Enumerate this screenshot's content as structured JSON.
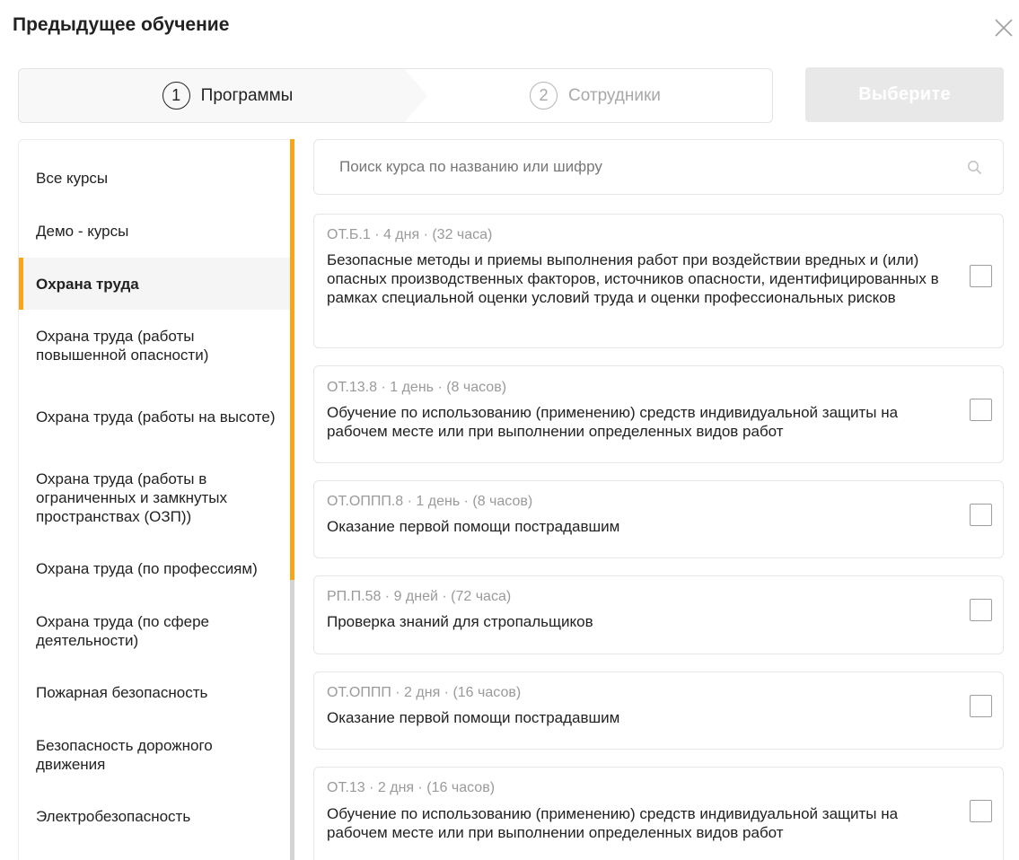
{
  "dialog": {
    "title": "Предыдущее обучение"
  },
  "stepper": {
    "steps": [
      {
        "number": "1",
        "label": "Программы",
        "active": true
      },
      {
        "number": "2",
        "label": "Сотрудники",
        "active": false
      }
    ]
  },
  "actions": {
    "select_label": "Выберите"
  },
  "sidebar": {
    "items": [
      {
        "label": "Все курсы"
      },
      {
        "label": "Демо - курсы"
      },
      {
        "label": "Охрана труда",
        "active": true
      },
      {
        "label": "Охрана труда (работы повышенной опасности)"
      },
      {
        "label": "Охрана труда (работы на высоте)"
      },
      {
        "label": "Охрана труда (работы в ограниченных и замкнутых пространствах (ОЗП))"
      },
      {
        "label": "Охрана труда (по профессиям)"
      },
      {
        "label": "Охрана труда (по сфере деятельности)"
      },
      {
        "label": "Пожарная безопасность"
      },
      {
        "label": "Безопасность дорожного движения"
      },
      {
        "label": "Электробезопасность"
      }
    ]
  },
  "search": {
    "placeholder": "Поиск курса по названию или шифру",
    "value": ""
  },
  "courses": [
    {
      "meta": "ОТ.Б.1 · 4 дня · (32 часа)",
      "title": "Безопасные методы и приемы выполнения работ при воздействии вредных и (или) опасных производственных факторов, источников опасности, идентифицированных в рамках специальной оценки условий труда и оценки профессиональных рисков",
      "checked": false
    },
    {
      "meta": "ОТ.13.8 · 1 день · (8 часов)",
      "title": "Обучение по использованию (применению) средств индивидуальной защиты на рабочем месте или при выполнении определенных видов работ",
      "checked": false
    },
    {
      "meta": "ОТ.ОППП.8 · 1 день · (8 часов)",
      "title": "Оказание первой помощи пострадавшим",
      "checked": false
    },
    {
      "meta": "РП.П.58 · 9 дней · (72 часа)",
      "title": "Проверка знаний для стропальщиков",
      "checked": false
    },
    {
      "meta": "ОТ.ОППП · 2 дня · (16 часов)",
      "title": "Оказание первой помощи пострадавшим",
      "checked": false
    },
    {
      "meta": "ОТ.13 · 2 дня · (16 часов)",
      "title": "Обучение по использованию (применению) средств индивидуальной защиты на рабочем месте или при выполнении определенных видов работ",
      "checked": false
    }
  ],
  "colors": {
    "accent": "#f9a51a",
    "muted_text": "#9a9a9a",
    "disabled_button": "#e8e8e8"
  }
}
